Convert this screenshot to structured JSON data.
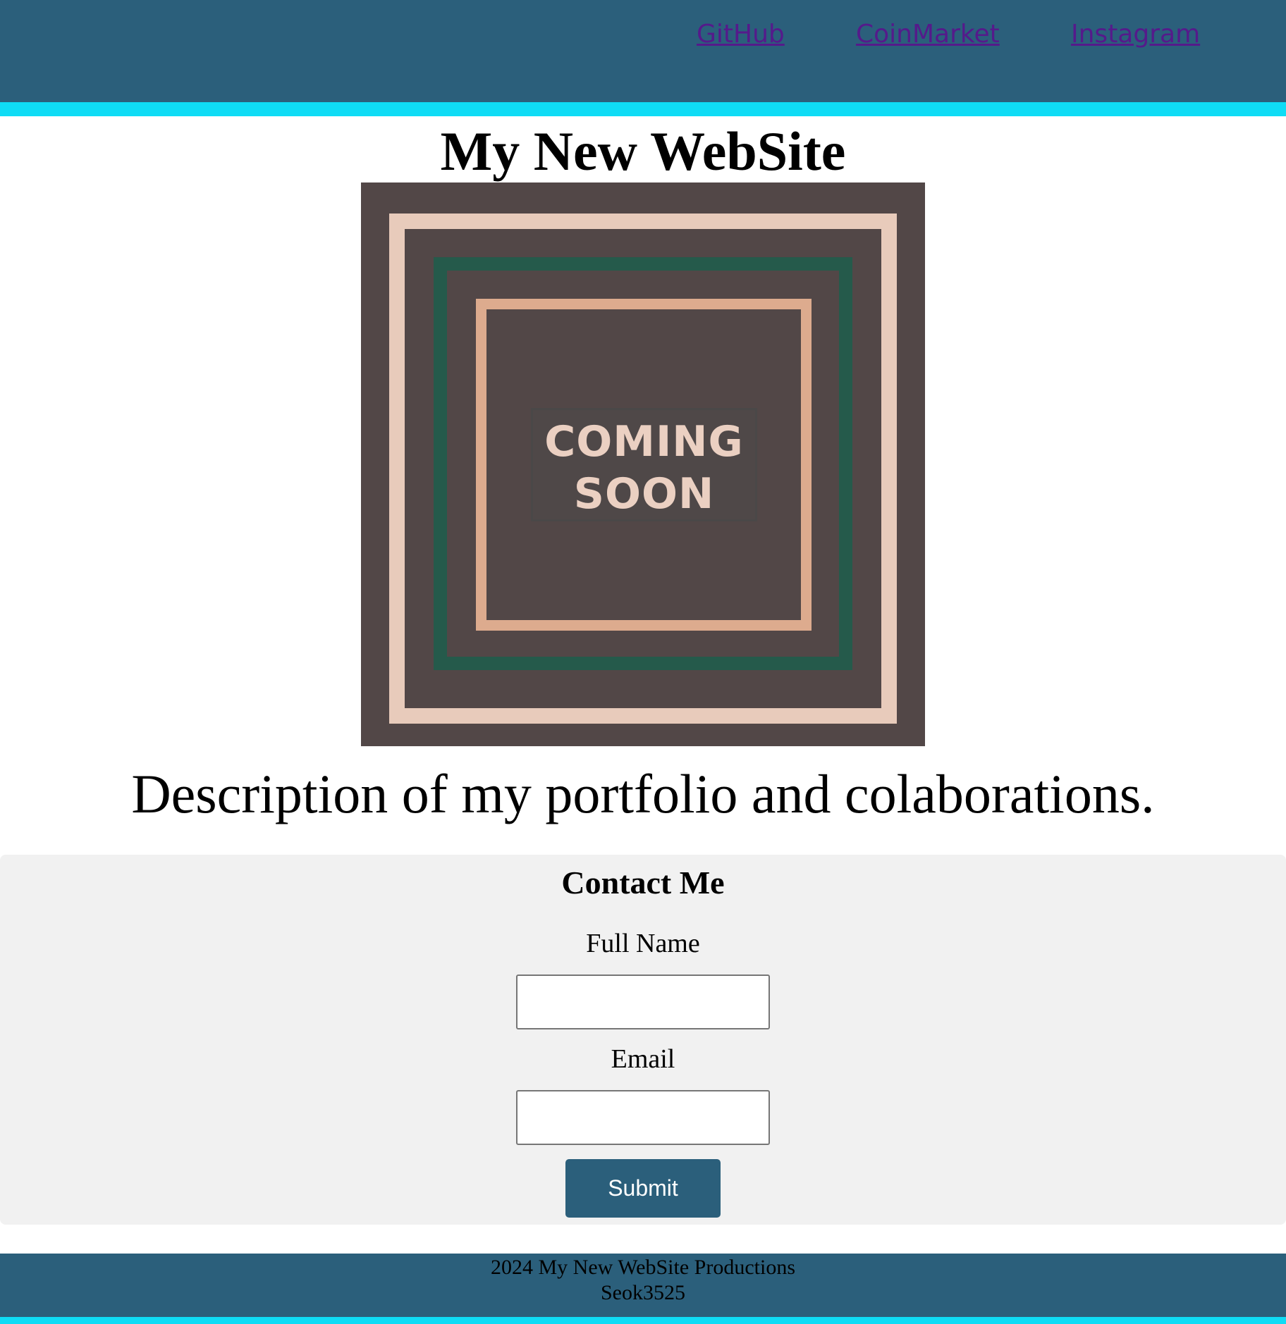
{
  "colors": {
    "header_bg": "#2b5f7b",
    "accent_stripe": "#0fdcf5",
    "link_visited": "#551a8b",
    "contact_bg": "#f1f1f1",
    "button_bg": "#2b5f7b",
    "image_bg": "#524747",
    "image_frame_outer": "#e8cbbb",
    "image_frame_green": "#255a4b",
    "image_frame_inner": "#ddab8e",
    "image_text": "#ebd0c2"
  },
  "nav": {
    "links": [
      {
        "label": "GitHub"
      },
      {
        "label": "CoinMarket"
      },
      {
        "label": "Instagram"
      }
    ]
  },
  "hero": {
    "title": "My New WebSite",
    "image_text_line1": "COMING",
    "image_text_line2": "SOON",
    "description": "Description of my portfolio and colaborations."
  },
  "contact": {
    "title": "Contact Me",
    "full_name_label": "Full Name",
    "full_name_value": "",
    "email_label": "Email",
    "email_value": "",
    "submit_label": "Submit"
  },
  "footer": {
    "line1": "2024 My New WebSite Productions",
    "line2": "Seok3525"
  }
}
